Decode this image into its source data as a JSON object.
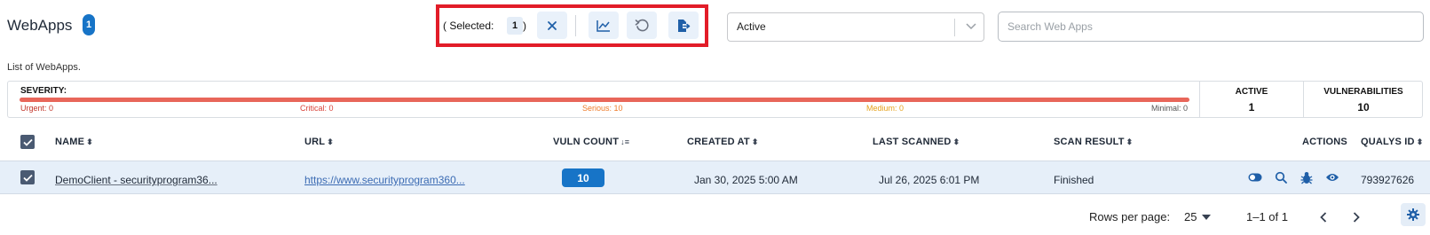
{
  "header": {
    "title": "WebApps",
    "count": "1",
    "subtitle": "List of WebApps."
  },
  "selection": {
    "label": "( Selected:",
    "count": "1",
    "close": ")",
    "actions": [
      "clear-selection",
      "chart",
      "reset",
      "export"
    ]
  },
  "status_filter": {
    "value": "Active"
  },
  "search": {
    "placeholder": "Search Web Apps"
  },
  "severity": {
    "label": "SEVERITY:",
    "items": [
      {
        "label": "Urgent: 0",
        "color": "#c2352a"
      },
      {
        "label": "Critical: 0",
        "color": "#d9433a"
      },
      {
        "label": "Serious: 10",
        "color": "#ee7b2a"
      },
      {
        "label": "Medium: 0",
        "color": "#e6a21d"
      },
      {
        "label": "Minimal: 0",
        "color": "#555555"
      }
    ],
    "bar_color": "#e8665a"
  },
  "stats": {
    "active_label": "ACTIVE",
    "active_value": "1",
    "vuln_label": "VULNERABILITIES",
    "vuln_value": "10"
  },
  "table": {
    "columns": {
      "name": "NAME",
      "url": "URL",
      "vuln_count": "VULN COUNT",
      "created_at": "CREATED AT",
      "last_scanned": "LAST SCANNED",
      "scan_result": "SCAN RESULT",
      "actions": "ACTIONS",
      "qualys_id": "QUALYS ID"
    },
    "rows": [
      {
        "selected": true,
        "name": "DemoClient - securityprogram36...",
        "url": "https://www.securityprogram360...",
        "vuln_count": "10",
        "created_at": "Jan 30, 2025 5:00 AM",
        "last_scanned": "Jul 26, 2025 6:01 PM",
        "scan_result": "Finished",
        "actions": [
          "toggle-icon",
          "search-icon",
          "bug-icon",
          "eye-icon"
        ],
        "qualys_id": "793927626"
      }
    ]
  },
  "pagination": {
    "rows_per_page_label": "Rows per page:",
    "rows_per_page_value": "25",
    "range": "1–1 of 1"
  },
  "colors": {
    "accent": "#1774c7",
    "highlight_border": "#e21c28",
    "row_selected": "#e6eff9"
  }
}
